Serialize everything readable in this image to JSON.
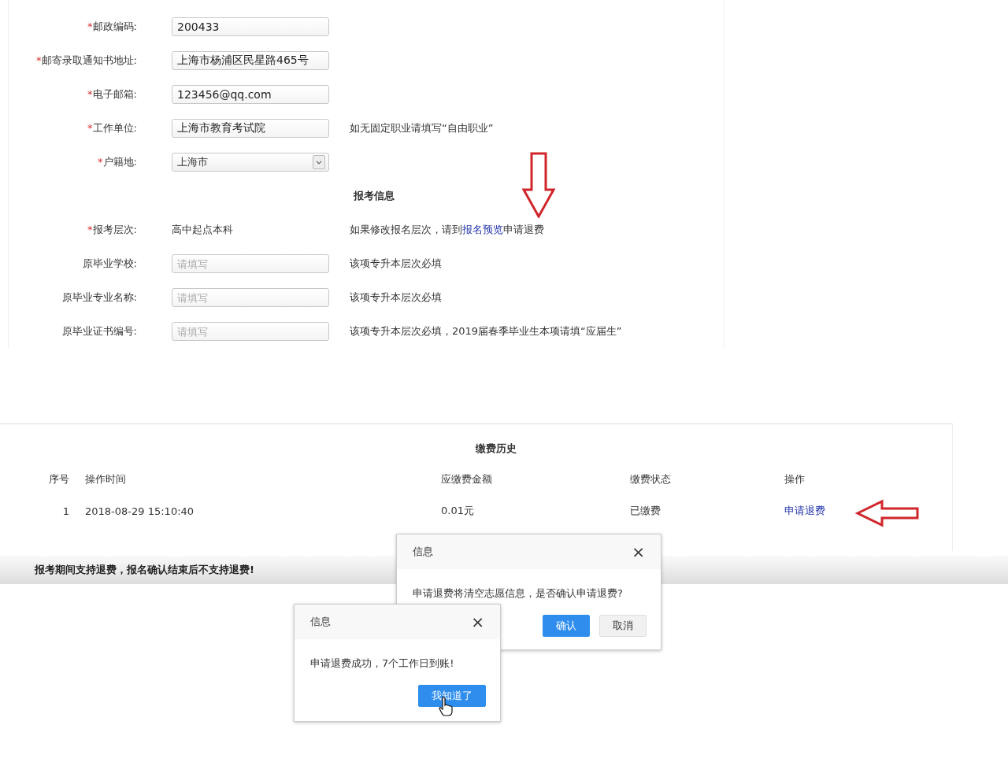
{
  "form": {
    "rows": [
      {
        "kind": "input",
        "mark": "*",
        "label": "邮政编码:",
        "value": "200433"
      },
      {
        "kind": "input",
        "mark": "*",
        "label": "邮寄录取通知书地址:",
        "value": "上海市杨浦区民星路465号"
      },
      {
        "kind": "input",
        "mark": "*",
        "label": "电子邮箱:",
        "value": "123456@qq.com"
      },
      {
        "kind": "input",
        "mark": "*",
        "label": "工作单位:",
        "value": "上海市教育考试院",
        "note": {
          "text": "如无固定职业请填写“自由职业”"
        }
      },
      {
        "kind": "select",
        "mark": "*",
        "label": "户籍地:",
        "value": "上海市"
      },
      {
        "kind": "heading",
        "label": "报考信息"
      },
      {
        "kind": "static",
        "mark": "*",
        "label": "报考层次:",
        "value": "高中起点本科",
        "note": {
          "text": "如果修改报名层次，请到",
          "link": "报名预览",
          "after": "申请退费"
        }
      },
      {
        "kind": "input",
        "label": "原毕业学校:",
        "placeholder": "请填写",
        "note": {
          "text": "该项专升本层次必填"
        }
      },
      {
        "kind": "input",
        "label": "原毕业专业名称:",
        "placeholder": "请填写",
        "note": {
          "text": "该项专升本层次必填"
        }
      },
      {
        "kind": "input",
        "label": "原毕业证书编号:",
        "placeholder": "请填写",
        "note": {
          "text": "该项专升本层次必填，2019届春季毕业生本项请填“应届生”"
        }
      }
    ]
  },
  "fee_history": {
    "title": "缴费历史",
    "columns": [
      "序号",
      "操作时间",
      "应缴费金额",
      "缴费状态",
      "操作"
    ],
    "rows": [
      {
        "index": "1",
        "time": "2018-08-29 15:10:40",
        "amount": "0.01元",
        "status": "已缴费",
        "action": "申请退费"
      }
    ]
  },
  "notice": "报考期间支持退费，报名确认结束后不支持退费!",
  "dialogs": [
    {
      "title": "信息",
      "close": "×",
      "message": "申请退费将清空志愿信息，是否确认申请退费?",
      "buttons": [
        {
          "label": "确认",
          "primary": true
        },
        {
          "label": "取消",
          "primary": false
        }
      ]
    },
    {
      "title": "信息",
      "close": "×",
      "message": "申请退费成功，7个工作日到账!",
      "buttons": [
        {
          "label": "我知道了",
          "primary": true
        }
      ]
    }
  ]
}
